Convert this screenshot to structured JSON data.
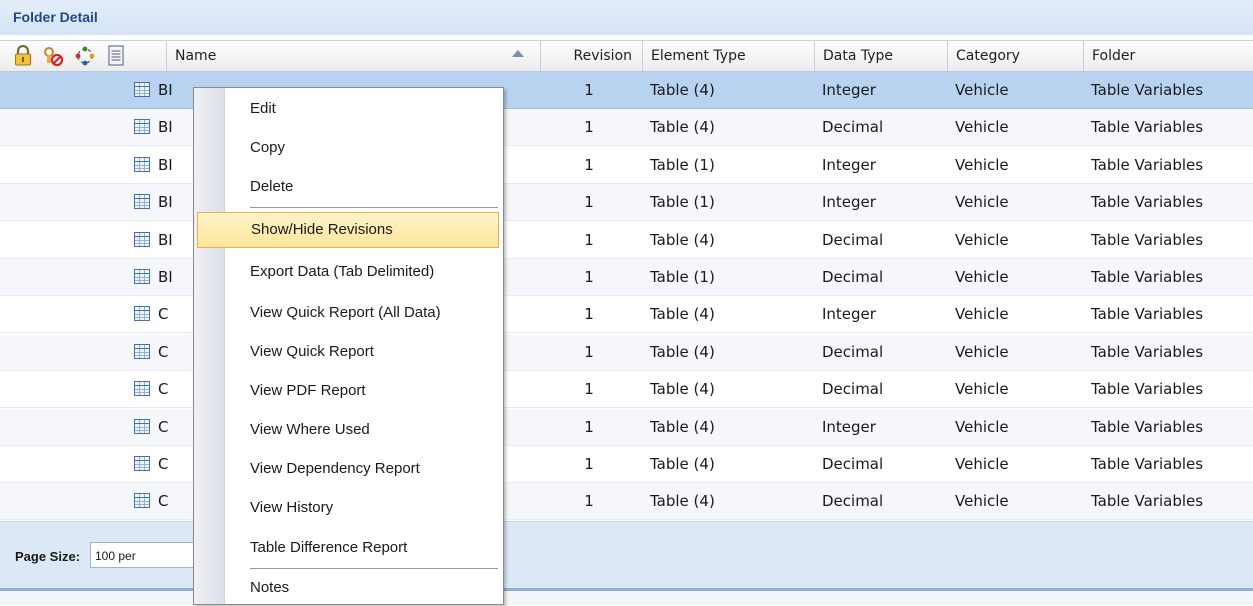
{
  "panel": {
    "title": "Folder Detail"
  },
  "header_icons": [
    "lock-icon",
    "checkout-prohibited-icon",
    "refresh-cycle-icon",
    "document-icon"
  ],
  "columns": {
    "name": "Name",
    "revision": "Revision",
    "element_type": "Element Type",
    "data_type": "Data Type",
    "category": "Category",
    "folder": "Folder"
  },
  "rows": [
    {
      "name": "BI",
      "revision": "1",
      "element_type": "Table (4)",
      "data_type": "Integer",
      "category": "Vehicle",
      "folder": "Table Variables"
    },
    {
      "name": "BI",
      "revision": "1",
      "element_type": "Table (4)",
      "data_type": "Decimal",
      "category": "Vehicle",
      "folder": "Table Variables"
    },
    {
      "name": "BI",
      "revision": "1",
      "element_type": "Table (1)",
      "data_type": "Integer",
      "category": "Vehicle",
      "folder": "Table Variables"
    },
    {
      "name": "BI",
      "revision": "1",
      "element_type": "Table (1)",
      "data_type": "Integer",
      "category": "Vehicle",
      "folder": "Table Variables"
    },
    {
      "name": "BI",
      "revision": "1",
      "element_type": "Table (4)",
      "data_type": "Decimal",
      "category": "Vehicle",
      "folder": "Table Variables"
    },
    {
      "name": "BI",
      "revision": "1",
      "element_type": "Table (1)",
      "data_type": "Decimal",
      "category": "Vehicle",
      "folder": "Table Variables"
    },
    {
      "name": "C",
      "revision": "1",
      "element_type": "Table (4)",
      "data_type": "Integer",
      "category": "Vehicle",
      "folder": "Table Variables"
    },
    {
      "name": "C",
      "revision": "1",
      "element_type": "Table (4)",
      "data_type": "Decimal",
      "category": "Vehicle",
      "folder": "Table Variables"
    },
    {
      "name": "C",
      "revision": "1",
      "element_type": "Table (4)",
      "data_type": "Decimal",
      "category": "Vehicle",
      "folder": "Table Variables"
    },
    {
      "name": "C",
      "revision": "1",
      "element_type": "Table (4)",
      "data_type": "Integer",
      "category": "Vehicle",
      "folder": "Table Variables"
    },
    {
      "name": "C",
      "revision": "1",
      "element_type": "Table (4)",
      "data_type": "Decimal",
      "category": "Vehicle",
      "folder": "Table Variables"
    },
    {
      "name": "C",
      "revision": "1",
      "element_type": "Table (4)",
      "data_type": "Decimal",
      "category": "Vehicle",
      "folder": "Table Variables"
    }
  ],
  "footer": {
    "page_size_label": "Page Size:",
    "page_size_value": "100 per"
  },
  "context_menu": {
    "items": [
      {
        "label": "Edit"
      },
      {
        "label": "Copy"
      },
      {
        "label": "Delete",
        "separator_after": true
      },
      {
        "label": "Show/Hide Revisions",
        "highlighted": true
      },
      {
        "label": "Export Data (Tab Delimited)"
      },
      {
        "label": "View Quick Report (All Data)"
      },
      {
        "label": "View Quick Report"
      },
      {
        "label": "View PDF Report"
      },
      {
        "label": "View Where Used"
      },
      {
        "label": "View Dependency Report"
      },
      {
        "label": "View History"
      },
      {
        "label": "Table Difference Report",
        "separator_after": true
      },
      {
        "label": "Notes"
      }
    ]
  },
  "colors": {
    "selected_row": "#b8d3f0",
    "menu_highlight": "#fde59a",
    "title_text": "#1f4a8a"
  }
}
